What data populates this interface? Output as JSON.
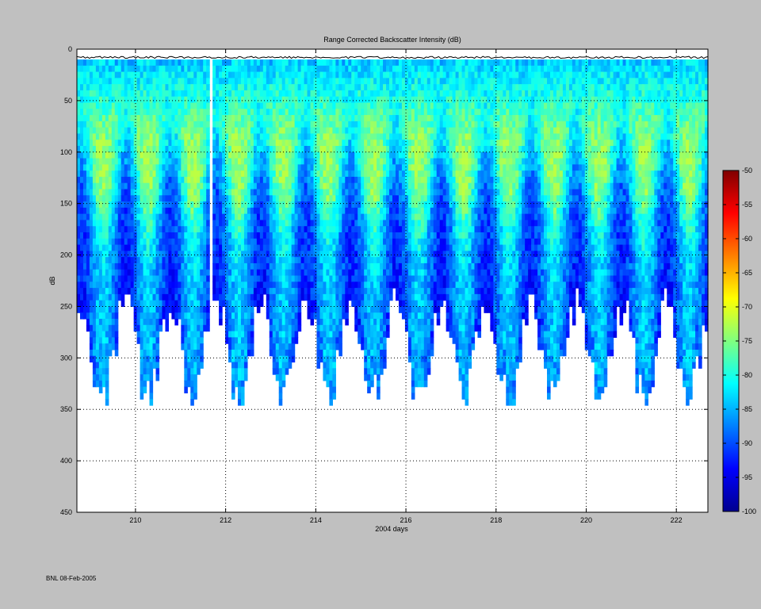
{
  "chart_data": {
    "type": "heatmap",
    "title": "Range Corrected Backscatter Intensity (dB)",
    "xlabel": "2004 days",
    "ylabel": "dB",
    "xlim": [
      208.7,
      222.7
    ],
    "ylim": [
      0,
      450
    ],
    "y_reversed": true,
    "grid": true,
    "x_ticks": [
      210,
      212,
      214,
      216,
      218,
      220,
      222
    ],
    "y_ticks": [
      0,
      50,
      100,
      150,
      200,
      250,
      300,
      350,
      400,
      450
    ],
    "colorbar": {
      "min": -100,
      "max": -50,
      "ticks": [
        -50,
        -55,
        -60,
        -65,
        -70,
        -75,
        -80,
        -85,
        -90,
        -95,
        -100
      ],
      "colormap": "jet"
    },
    "color_range_observed": [
      -95,
      -72
    ],
    "surface_line_depth": 8,
    "data_bottom_range": [
      230,
      345
    ],
    "gaps_x": [
      211.6,
      211.7
    ]
  },
  "footer": {
    "credit": "BNL 08-Feb-2005"
  }
}
